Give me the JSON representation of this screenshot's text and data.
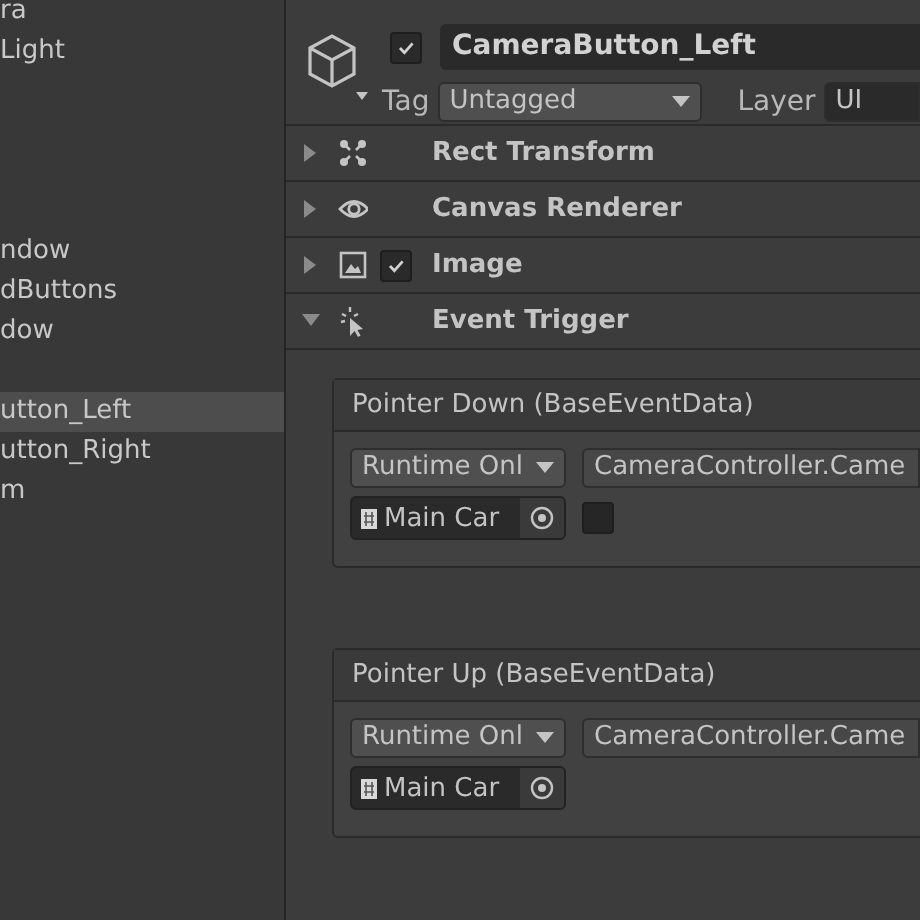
{
  "hierarchy": {
    "items": [
      {
        "label": "ra",
        "selected": false
      },
      {
        "label": "Light",
        "selected": false
      },
      {
        "selected": false
      },
      {
        "selected": false
      },
      {
        "selected": false
      },
      {
        "selected": false
      },
      {
        "label": "ndow",
        "selected": false
      },
      {
        "label": "dButtons",
        "selected": false
      },
      {
        "label": "dow",
        "selected": false
      },
      {
        "selected": false
      },
      {
        "label": "utton_Left",
        "selected": true
      },
      {
        "label": "utton_Right",
        "selected": false
      },
      {
        "label": "m",
        "selected": false
      }
    ]
  },
  "inspector": {
    "active": true,
    "name": "CameraButton_Left",
    "tag_label": "Tag",
    "tag": "Untagged",
    "layer_label": "Layer",
    "layer": "UI",
    "components": [
      {
        "kind": "rect",
        "title": "Rect Transform",
        "expanded": false
      },
      {
        "kind": "eye",
        "title": "Canvas Renderer",
        "expanded": false
      },
      {
        "kind": "image",
        "title": "Image",
        "expanded": false,
        "checked": true
      },
      {
        "kind": "trigger",
        "title": "Event Trigger",
        "expanded": true
      }
    ],
    "events": [
      {
        "title": "Pointer Down (BaseEventData)",
        "mode": "Runtime Onl",
        "function": "CameraController.Came",
        "object": "Main Car",
        "argument": {
          "checked": false
        }
      },
      {
        "title": "Pointer Up (BaseEventData)",
        "mode": "Runtime Onl",
        "function": "CameraController.Came",
        "object": "Main Car"
      }
    ]
  }
}
